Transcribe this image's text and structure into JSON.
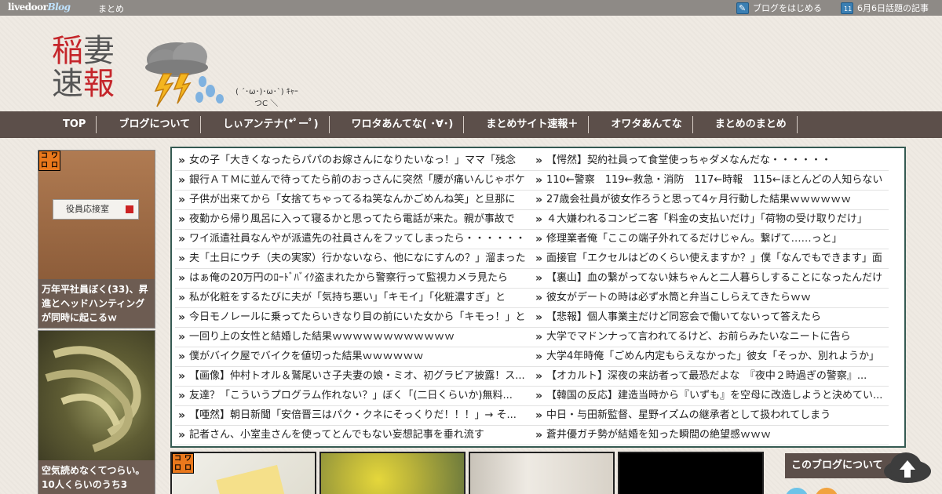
{
  "topbar": {
    "logo_main": "livedoor",
    "logo_blog": "Blog",
    "matome": "まとめ",
    "start_blog": "ブログをはじめる",
    "today_topics": "6月6日話題の記事"
  },
  "header": {
    "title_line1_a": "稲",
    "title_line1_b": "妻",
    "title_line2_a": "速",
    "title_line2_b": "報",
    "kaomoji": "( ´･ω･)･ω･`)  ｷｬｰ",
    "kaomoji2": "つC        ＼"
  },
  "nav": {
    "items": [
      "TOP",
      "ブログについて",
      "しぃアンテナ(*ﾟーﾟ)",
      "ワロタあんてな( ･∀･)",
      "まとめサイト速報＋",
      "オワタあんてな",
      "まとめのまとめ"
    ]
  },
  "sidebar": {
    "card1": {
      "caption": "万年平社員ぼく(33)、昇進とヘッドハンティングが同時に起こるｗ",
      "sign_text": "役員応接室"
    },
    "card2": {
      "caption": "空気読めなくてつらい。10人くらいのうち3"
    },
    "badge": [
      "コ",
      "ワ",
      "ロ",
      "ロ"
    ]
  },
  "headlines": {
    "left": [
      "女の子「大きくなったらパパのお嫁さんになりたいなっ！」ママ「残念",
      "銀行ＡＴＭに並んで待ってたら前のおっさんに突然「腰が痛いんじゃボケ",
      "子供が出来てから「女捨てちゃってるね笑なんかごめんね笑」と旦那に",
      "夜勤から帰り風呂に入って寝るかと思ってたら電話が来た。親が事故で",
      "ワイ派遣社員なんやが派遣先の社員さんをフッてしまったら・・・・・・",
      "夫「土日にウチ（夫の実家）行かないなら、他になにすんの？」溜まった",
      "はぁ俺の20万円のﾛｰﾄﾞﾊﾞｲｸ盗まれたから警察行って監視カメラ見たら",
      "私が化粧をするたびに夫が「気持ち悪い」「キモイ」「化粧濃すぎ」と",
      "今日モノレールに乗ってたらいきなり目の前にいた女から「キモっ！」と",
      "一回り上の女性と結婚した結果ｗｗｗｗｗｗｗｗｗｗｗｗ",
      "僕がバイク屋でバイクを値切った結果ｗｗｗｗｗｗ",
      "【画像】仲村トオル＆鷲尾いさ子夫妻の娘・ミオ、初グラビア披露！ス...",
      "友達？「こういうプログラム作れない？」ぼく「(二日くらいか)無料...",
      "【唖然】朝日新聞「安倍晋三はパク・クネにそっくりだ！！！」→ そ...",
      "記者さん、小室圭さんを使ってとんでもない妄想記事を垂れ流す"
    ],
    "right": [
      "【愕然】契約社員って食堂使っちゃダメなんだな・・・・・・",
      "110←警察　119←救急・消防　117←時報　115←ほとんどの人知らない",
      "27歳会社員が彼女作ろうと思って4ヶ月行動した結果ｗｗｗｗｗｗ",
      "４大嫌われるコンビニ客「料金の支払いだけ」「荷物の受け取りだけ」",
      "修理業者俺「ここの端子外れてるだけじゃん。繋げて……っと」",
      "面接官「エクセルはどのくらい使えますか？」僕「なんでもできます」面",
      "【裏山】血の繋がってない妹ちゃんと二人暮らしすることになったんだけ",
      "彼女がデートの時は必ず水筒と弁当こしらえてきたらｗｗ",
      "【悲報】個人事業主だけど同窓会で働いてないって答えたら",
      "大学でマドンナって言われてるけど、お前らみたいなニートに告ら",
      "大学4年時俺「ごめん内定もらえなかった」彼女「そっか、別れようか」",
      "【オカルト】深夜の来訪者って最恐だよな　『夜中２時過ぎの警察』...",
      "【韓国の反応】建造当時から『いずも』を空母に改造しようと決めてい...",
      "中日・与田新監督、星野イズムの継承者として扱われてしまう",
      "蒼井優ガチ勢が結婚を知った瞬間の絶望感ｗｗｗ"
    ]
  },
  "bottom": {
    "about_label": "このブログについて"
  }
}
